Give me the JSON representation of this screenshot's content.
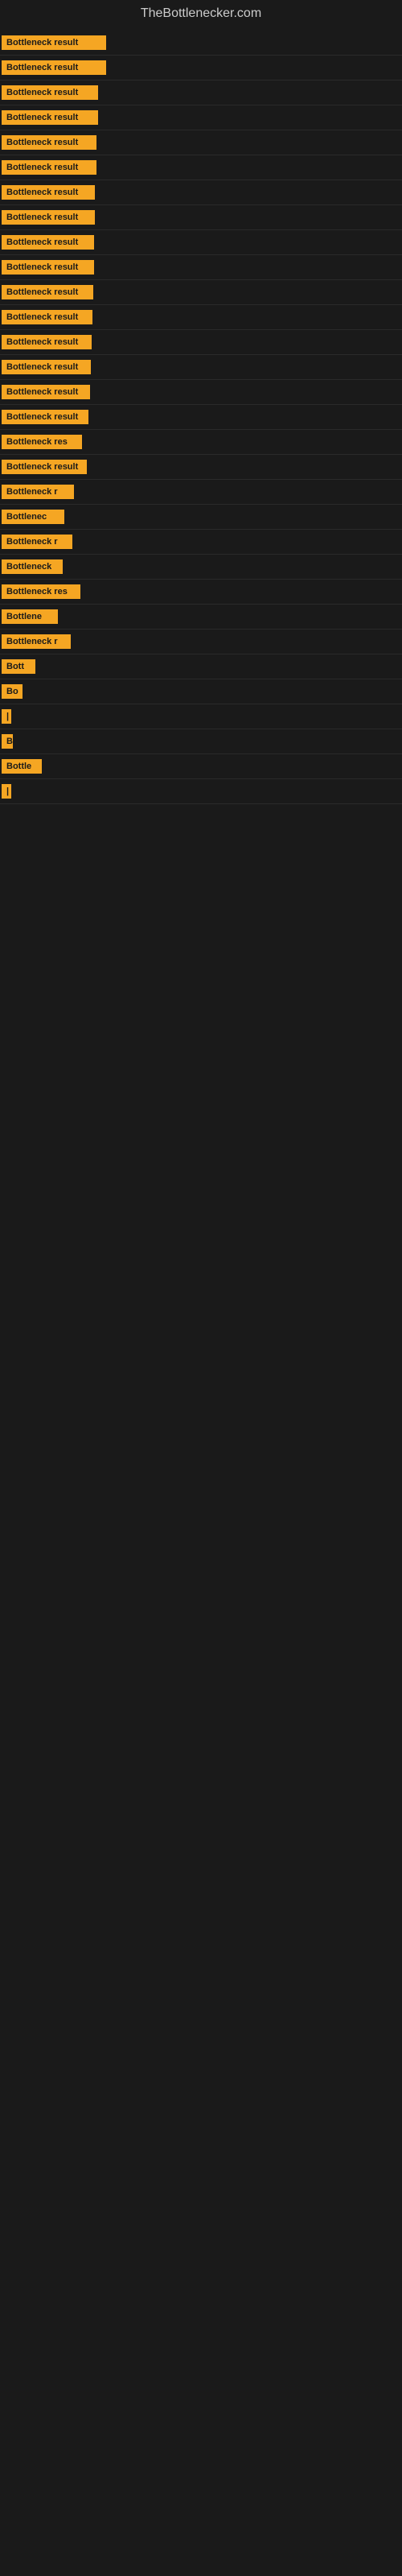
{
  "site": {
    "title": "TheBottlenecker.com"
  },
  "items": [
    {
      "label": "Bottleneck result",
      "width": 130
    },
    {
      "label": "Bottleneck result",
      "width": 130
    },
    {
      "label": "Bottleneck result",
      "width": 120
    },
    {
      "label": "Bottleneck result",
      "width": 120
    },
    {
      "label": "Bottleneck result",
      "width": 118
    },
    {
      "label": "Bottleneck result",
      "width": 118
    },
    {
      "label": "Bottleneck result",
      "width": 116
    },
    {
      "label": "Bottleneck result",
      "width": 116
    },
    {
      "label": "Bottleneck result",
      "width": 115
    },
    {
      "label": "Bottleneck result",
      "width": 115
    },
    {
      "label": "Bottleneck result",
      "width": 114
    },
    {
      "label": "Bottleneck result",
      "width": 113
    },
    {
      "label": "Bottleneck result",
      "width": 112
    },
    {
      "label": "Bottleneck result",
      "width": 111
    },
    {
      "label": "Bottleneck result",
      "width": 110
    },
    {
      "label": "Bottleneck result",
      "width": 108
    },
    {
      "label": "Bottleneck res",
      "width": 100
    },
    {
      "label": "Bottleneck result",
      "width": 106
    },
    {
      "label": "Bottleneck r",
      "width": 90
    },
    {
      "label": "Bottlenec",
      "width": 78
    },
    {
      "label": "Bottleneck r",
      "width": 88
    },
    {
      "label": "Bottleneck",
      "width": 76
    },
    {
      "label": "Bottleneck res",
      "width": 98
    },
    {
      "label": "Bottlene",
      "width": 70
    },
    {
      "label": "Bottleneck r",
      "width": 86
    },
    {
      "label": "Bott",
      "width": 42
    },
    {
      "label": "Bo",
      "width": 26
    },
    {
      "label": "|",
      "width": 8
    },
    {
      "label": "B",
      "width": 14
    },
    {
      "label": "Bottle",
      "width": 50
    },
    {
      "label": "|",
      "width": 8
    }
  ]
}
